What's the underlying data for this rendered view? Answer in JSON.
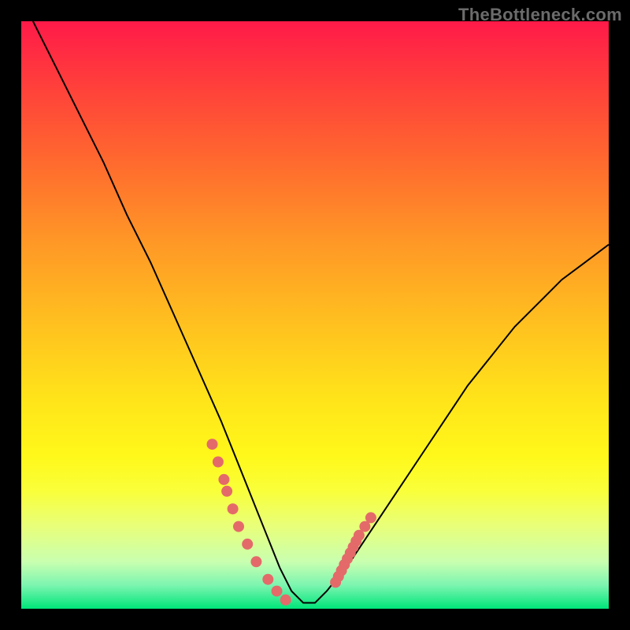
{
  "watermark": "TheBottleneck.com",
  "chart_data": {
    "type": "line",
    "title": "",
    "xlabel": "",
    "ylabel": "",
    "xlim": [
      0,
      100
    ],
    "ylim": [
      0,
      100
    ],
    "grid": false,
    "series": [
      {
        "name": "curve",
        "x": [
          2,
          6,
          10,
          14,
          18,
          22,
          26,
          30,
          34,
          36,
          38,
          40,
          42,
          44,
          46,
          48,
          50,
          52,
          56,
          60,
          64,
          68,
          72,
          76,
          80,
          84,
          88,
          92,
          96,
          100
        ],
        "y": [
          100,
          92,
          84,
          76,
          67,
          59,
          50,
          41,
          32,
          27,
          22,
          17,
          12,
          7,
          3,
          1,
          1,
          3,
          8,
          14,
          20,
          26,
          32,
          38,
          43,
          48,
          52,
          56,
          59,
          62
        ]
      }
    ],
    "points_left": {
      "name": "dots-left",
      "x": [
        32.5,
        33.5,
        34.5,
        35.0,
        36.0,
        37.0,
        38.5,
        40.0,
        42.0,
        43.5,
        45.0
      ],
      "y": [
        28,
        25,
        22,
        20,
        17,
        14,
        11,
        8,
        5,
        3,
        1.5
      ]
    },
    "points_right": {
      "name": "dots-right",
      "x": [
        53.5,
        54.0,
        54.5,
        55.0,
        55.5,
        56.0,
        56.5,
        57.0,
        57.5,
        58.5,
        59.5
      ],
      "y": [
        4.5,
        5.5,
        6.5,
        7.5,
        8.5,
        9.5,
        10.5,
        11.5,
        12.5,
        14,
        15.5
      ]
    }
  }
}
